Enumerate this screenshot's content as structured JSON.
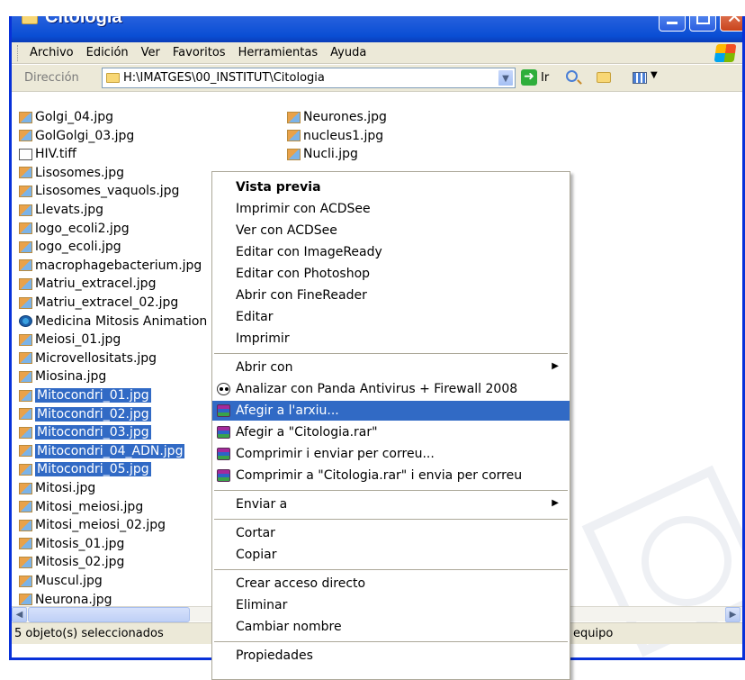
{
  "window": {
    "title": "Citologia",
    "menu": [
      "Archivo",
      "Edición",
      "Ver",
      "Favoritos",
      "Herramientas",
      "Ayuda"
    ]
  },
  "address": {
    "label": "Dirección",
    "path": "H:\\IMATGES\\00_INSTITUT\\Citologia",
    "go_label": "Ir"
  },
  "files_col1": [
    {
      "name": "Golgi_04.jpg",
      "type": "jpg",
      "selected": false
    },
    {
      "name": "GolGolgi_03.jpg",
      "type": "jpg",
      "selected": false
    },
    {
      "name": "HIV.tiff",
      "type": "tiff",
      "selected": false
    },
    {
      "name": "Lisosomes.jpg",
      "type": "jpg",
      "selected": false
    },
    {
      "name": "Lisosomes_vaquols.jpg",
      "type": "jpg",
      "selected": false
    },
    {
      "name": "Llevats.jpg",
      "type": "jpg",
      "selected": false
    },
    {
      "name": "logo_ecoli2.jpg",
      "type": "jpg",
      "selected": false
    },
    {
      "name": "logo_ecoli.jpg",
      "type": "jpg",
      "selected": false
    },
    {
      "name": "macrophagebacterium.jpg",
      "type": "jpg",
      "selected": false
    },
    {
      "name": "Matriu_extracel.jpg",
      "type": "jpg",
      "selected": false
    },
    {
      "name": "Matriu_extracel_02.jpg",
      "type": "jpg",
      "selected": false
    },
    {
      "name": "Medicina Mitosis Animation",
      "type": "anim",
      "selected": false
    },
    {
      "name": "Meiosi_01.jpg",
      "type": "jpg",
      "selected": false
    },
    {
      "name": "Microvellositats.jpg",
      "type": "jpg",
      "selected": false
    },
    {
      "name": "Miosina.jpg",
      "type": "jpg",
      "selected": false
    },
    {
      "name": "Mitocondri_01.jpg",
      "type": "jpg",
      "selected": true
    },
    {
      "name": "Mitocondri_02.jpg",
      "type": "jpg",
      "selected": true
    },
    {
      "name": "Mitocondri_03.jpg",
      "type": "jpg",
      "selected": true
    },
    {
      "name": "Mitocondri_04_ADN.jpg",
      "type": "jpg",
      "selected": true
    },
    {
      "name": "Mitocondri_05.jpg",
      "type": "jpg",
      "selected": true
    },
    {
      "name": "Mitosi.jpg",
      "type": "jpg",
      "selected": false
    },
    {
      "name": "Mitosi_meiosi.jpg",
      "type": "jpg",
      "selected": false
    },
    {
      "name": "Mitosi_meiosi_02.jpg",
      "type": "jpg",
      "selected": false
    },
    {
      "name": "Mitosis_01.jpg",
      "type": "jpg",
      "selected": false
    },
    {
      "name": "Mitosis_02.jpg",
      "type": "jpg",
      "selected": false
    },
    {
      "name": "Muscul.jpg",
      "type": "jpg",
      "selected": false
    },
    {
      "name": "Neurona.jpg",
      "type": "jpg",
      "selected": false
    }
  ],
  "files_col2": [
    {
      "name": "Neurones.jpg",
      "type": "jpg",
      "selected": false
    },
    {
      "name": "nucleus1.jpg",
      "type": "jpg",
      "selected": false
    },
    {
      "name": "Nucli.jpg",
      "type": "jpg",
      "selected": false
    }
  ],
  "context_menu": {
    "items": [
      {
        "label": "Vista previa",
        "bold": true
      },
      {
        "label": "Imprimir con ACDSee"
      },
      {
        "label": "Ver con ACDSee"
      },
      {
        "label": "Editar con ImageReady"
      },
      {
        "label": "Editar con Photoshop"
      },
      {
        "label": "Abrir con FineReader"
      },
      {
        "label": "Editar"
      },
      {
        "label": "Imprimir"
      },
      {
        "sep": true
      },
      {
        "label": "Abrir con",
        "submenu": true
      },
      {
        "label": "Analizar con Panda Antivirus + Firewall 2008",
        "icon": "panda-icon"
      },
      {
        "label": "Afegir a l'arxiu...",
        "icon": "winrar-icon",
        "highlight": true
      },
      {
        "label": "Afegir a \"Citologia.rar\"",
        "icon": "winrar-icon"
      },
      {
        "label": "Comprimir i enviar per correu...",
        "icon": "winrar-icon"
      },
      {
        "label": "Comprimir a \"Citologia.rar\" i envia per correu",
        "icon": "winrar-icon"
      },
      {
        "sep": true
      },
      {
        "label": "Enviar a",
        "submenu": true
      },
      {
        "sep": true
      },
      {
        "label": "Cortar"
      },
      {
        "label": "Copiar"
      },
      {
        "sep": true
      },
      {
        "label": "Crear acceso directo"
      },
      {
        "label": "Eliminar"
      },
      {
        "label": "Cambiar nombre"
      },
      {
        "sep": true
      },
      {
        "label": "Propiedades"
      }
    ]
  },
  "status": {
    "left": "5 objeto(s) seleccionados",
    "right": "equipo"
  },
  "colors": {
    "selection": "#316ac5",
    "titlebar": "#0a4ed4",
    "chrome": "#ece9d8"
  }
}
